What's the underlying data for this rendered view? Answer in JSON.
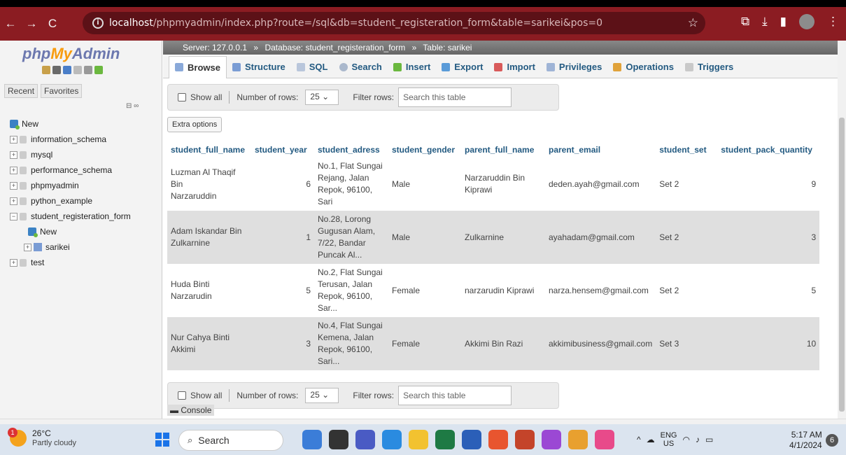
{
  "browser": {
    "url_host": "localhost",
    "url_path": "/phpmyadmin/index.php?route=/sql&db=student_registeration_form&table=sarikei&pos=0",
    "back_icon": "←",
    "forward_icon": "→",
    "reload_icon": "C",
    "star_icon": "☆"
  },
  "sidebar": {
    "logo_php": "php",
    "logo_my": "My",
    "logo_admin": "Admin",
    "recent_label": "Recent",
    "favorites_label": "Favorites",
    "tree": [
      {
        "label": "New",
        "type": "new"
      },
      {
        "label": "information_schema",
        "type": "db"
      },
      {
        "label": "mysql",
        "type": "db"
      },
      {
        "label": "performance_schema",
        "type": "db"
      },
      {
        "label": "phpmyadmin",
        "type": "db"
      },
      {
        "label": "python_example",
        "type": "db"
      },
      {
        "label": "student_registeration_form",
        "type": "db-open"
      },
      {
        "label": "New",
        "type": "sub-new"
      },
      {
        "label": "sarikei",
        "type": "sub-table"
      },
      {
        "label": "test",
        "type": "db"
      }
    ]
  },
  "breadcrumb": {
    "server": "Server: 127.0.0.1",
    "database": "Database: student_registeration_form",
    "table": "Table: sarikei",
    "sep": "»"
  },
  "tabs": [
    "Browse",
    "Structure",
    "SQL",
    "Search",
    "Insert",
    "Export",
    "Import",
    "Privileges",
    "Operations",
    "Triggers"
  ],
  "navigation": {
    "show_all": "Show all",
    "number_of_rows_label": "Number of rows:",
    "rows_value": "25",
    "filter_label": "Filter rows:",
    "filter_placeholder": "Search this table"
  },
  "extra_options": "Extra options",
  "table": {
    "columns": [
      "student_full_name",
      "student_year",
      "student_adress",
      "student_gender",
      "parent_full_name",
      "parent_email",
      "student_set",
      "student_pack_quantity"
    ],
    "rows": [
      {
        "name": [
          "Luzman Al Thaqif Bin",
          "Narzaruddin"
        ],
        "year": "6",
        "address": [
          "No.1, Flat Sungai",
          "Rejang, Jalan",
          "Repok, 96100,",
          "Sari"
        ],
        "gender": "Male",
        "parent": [
          "Narzaruddin Bin",
          "Kiprawi"
        ],
        "email": "deden.ayah@gmail.com",
        "set": "Set 2",
        "qty": "9"
      },
      {
        "name": [
          "Adam Iskandar Bin",
          "Zulkarnine"
        ],
        "year": "1",
        "address": [
          "No.28, Lorong",
          "Gugusan Alam,",
          "7/22, Bandar",
          "Puncak Al..."
        ],
        "gender": "Male",
        "parent": [
          "Zulkarnine"
        ],
        "email": "ayahadam@gmail.com",
        "set": "Set 2",
        "qty": "3"
      },
      {
        "name": [
          "Huda Binti",
          "Narzarudin"
        ],
        "year": "5",
        "address": [
          "No.2, Flat Sungai",
          "Terusan, Jalan",
          "Repok, 96100,",
          "Sar..."
        ],
        "gender": "Female",
        "parent": [
          "narzarudin Kiprawi"
        ],
        "email": "narza.hensem@gmail.com",
        "set": "Set 2",
        "qty": "5"
      },
      {
        "name": [
          "Nur Cahya Binti",
          "Akkimi"
        ],
        "year": "3",
        "address": [
          "No.4, Flat Sungai",
          "Kemena, Jalan",
          "Repok, 96100,",
          "Sari..."
        ],
        "gender": "Female",
        "parent": [
          "Akkimi Bin Razi"
        ],
        "email": "akkimibusiness@gmail.com",
        "set": "Set 3",
        "qty": "10"
      }
    ]
  },
  "console_label": "Console",
  "taskbar": {
    "temp": "26°C",
    "weather": "Partly cloudy",
    "badge": "1",
    "search": "Search",
    "lang_top": "ENG",
    "lang_bottom": "US",
    "time": "5:17 AM",
    "date": "4/1/2024",
    "notif_count": "6"
  }
}
